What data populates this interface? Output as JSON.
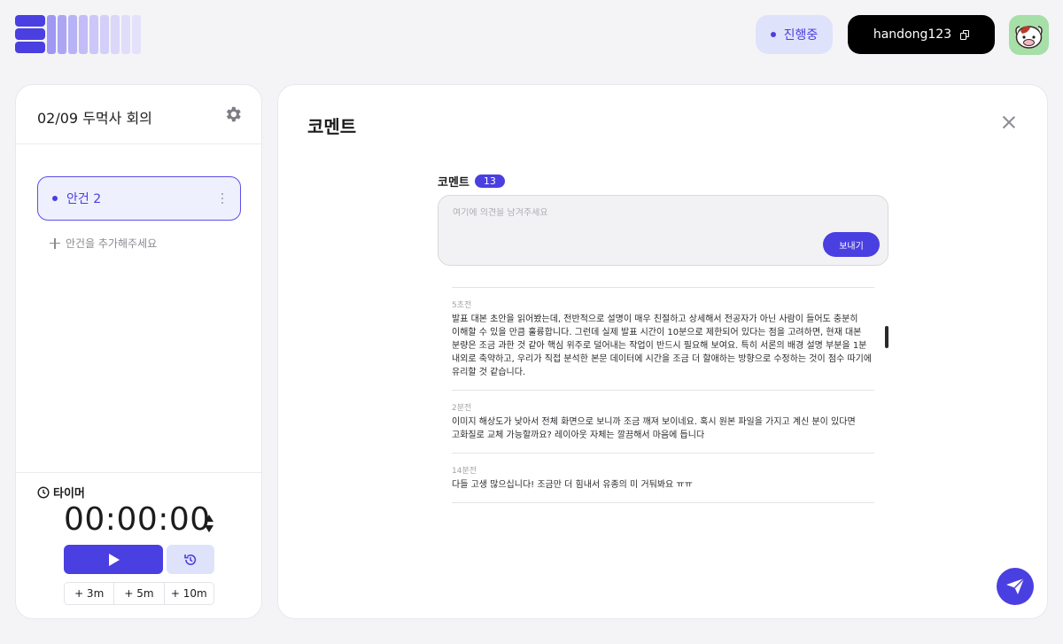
{
  "colors": {
    "accent": "#4a3fe0",
    "accent_light": "#dfe2fb",
    "background": "#f4f4f6"
  },
  "header": {
    "status_label": "진행중",
    "username": "handong123",
    "icons": {
      "copy": "copy-icon",
      "avatar": "cow-avatar"
    }
  },
  "sidebar": {
    "meeting_title": "02/09 두먹사 회의",
    "agenda_items": [
      {
        "label": "안건 2",
        "selected": true
      }
    ],
    "add_agenda_label": "안건을 추가해주세요",
    "timer": {
      "label": "타이머",
      "value": "00:00:00",
      "add_buttons": [
        "+ 3m",
        "+ 5m",
        "+ 10m"
      ]
    }
  },
  "main": {
    "title": "코멘트",
    "comment_header": "코멘트",
    "comment_count": "13",
    "input_placeholder": "여기에 의견을 남겨주세요",
    "send_label": "보내기",
    "comments": [
      {
        "time": "5초전",
        "text": "발표 대본 초안을 읽어봤는데, 전반적으로 설명이 매우 친절하고 상세해서 전공자가 아닌 사람이 들어도 충분히 이해할 수 있을 만큼 훌륭합니다. 그런데 실제 발표 시간이 10분으로 제한되어 있다는 점을 고려하면, 현재 대본 분량은 조금 과한 것 같아 핵심 위주로 덜어내는 작업이 반드시 필요해 보여요. 특히 서론의 배경 설명 부분을 1분 내외로 축약하고, 우리가 직접 분석한 본문 데이터에 시간을 조금 더 할애하는 방향으로 수정하는 것이 점수 따기에 유리할 것 같습니다."
      },
      {
        "time": "2분전",
        "text": "이미지 해상도가 낮아서 전체 화면으로 보니까 조금 깨져 보이네요. 혹시 원본 파일을 가지고 계신 분이 있다면 고화질로 교체 가능할까요? 레이아웃 자체는 깔끔해서 마음에 듭니다"
      },
      {
        "time": "14분전",
        "text": "다들 고생 많으십니다! 조금만 더 힘내서 유종의 미 거둬봐요 ㅠㅠ"
      }
    ]
  }
}
